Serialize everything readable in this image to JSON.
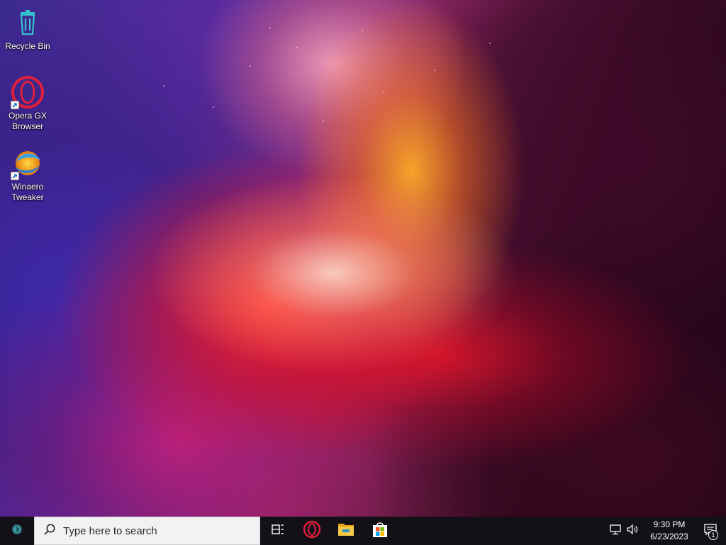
{
  "desktop": {
    "icons": [
      {
        "label": "Recycle Bin",
        "icon": "recycle-bin-icon",
        "shortcut": false
      },
      {
        "label": "Opera GX\nBrowser",
        "icon": "opera-gx-icon",
        "shortcut": true
      },
      {
        "label": "Winaero\nTweaker",
        "icon": "winaero-tweaker-icon",
        "shortcut": true
      }
    ]
  },
  "taskbar": {
    "search_placeholder": "Type here to search",
    "pinned_apps": [
      {
        "name": "Task View",
        "icon": "task-view-icon"
      },
      {
        "name": "Opera GX",
        "icon": "opera-gx-icon"
      },
      {
        "name": "File Explorer",
        "icon": "file-explorer-icon"
      },
      {
        "name": "Microsoft Store",
        "icon": "microsoft-store-icon"
      }
    ],
    "tray": {
      "time": "9:30 PM",
      "date": "6/23/2023",
      "notification_count": "1",
      "icons": [
        "network-icon",
        "volume-icon"
      ]
    }
  },
  "colors": {
    "taskbar_bg": "#141018",
    "search_bg": "#f2f2f2",
    "opera_red": "#e0203a",
    "store_blue": "#0f7fd8"
  }
}
